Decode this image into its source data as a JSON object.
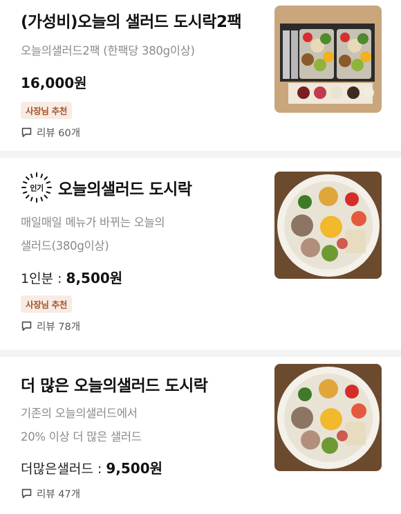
{
  "items": [
    {
      "title": "(가성비)오늘의 샐러드 도시락2팩",
      "desc_lines": [
        "오늘의샐러드2팩 (한팩당 380g이상)"
      ],
      "price_prefix": "",
      "price": "16,000원",
      "badge": "사장님 추천",
      "review": "리뷰 60개"
    },
    {
      "popular_label": "인기",
      "title": "오늘의샐러드 도시락",
      "desc_lines": [
        "매일매일 메뉴가 바뀌는 오늘의",
        "샐러드(380g이상)"
      ],
      "price_prefix": "1인분 : ",
      "price": "8,500원",
      "badge": "사장님 추천",
      "review": "리뷰 78개"
    },
    {
      "title": "더 많은 오늘의샐러드 도시락",
      "desc_lines": [
        "기존의 오늘의샐러드에서",
        "20% 이상 더 많은 샐러드"
      ],
      "price_prefix": "더많은샐러드 : ",
      "price": "9,500원",
      "review": "리뷰 47개"
    }
  ],
  "icons": {
    "review": "speech-bubble-icon",
    "popular": "popular-sunburst-badge"
  },
  "colors": {
    "badge_text": "#a6542b",
    "badge_bg": "#f7ece4"
  }
}
